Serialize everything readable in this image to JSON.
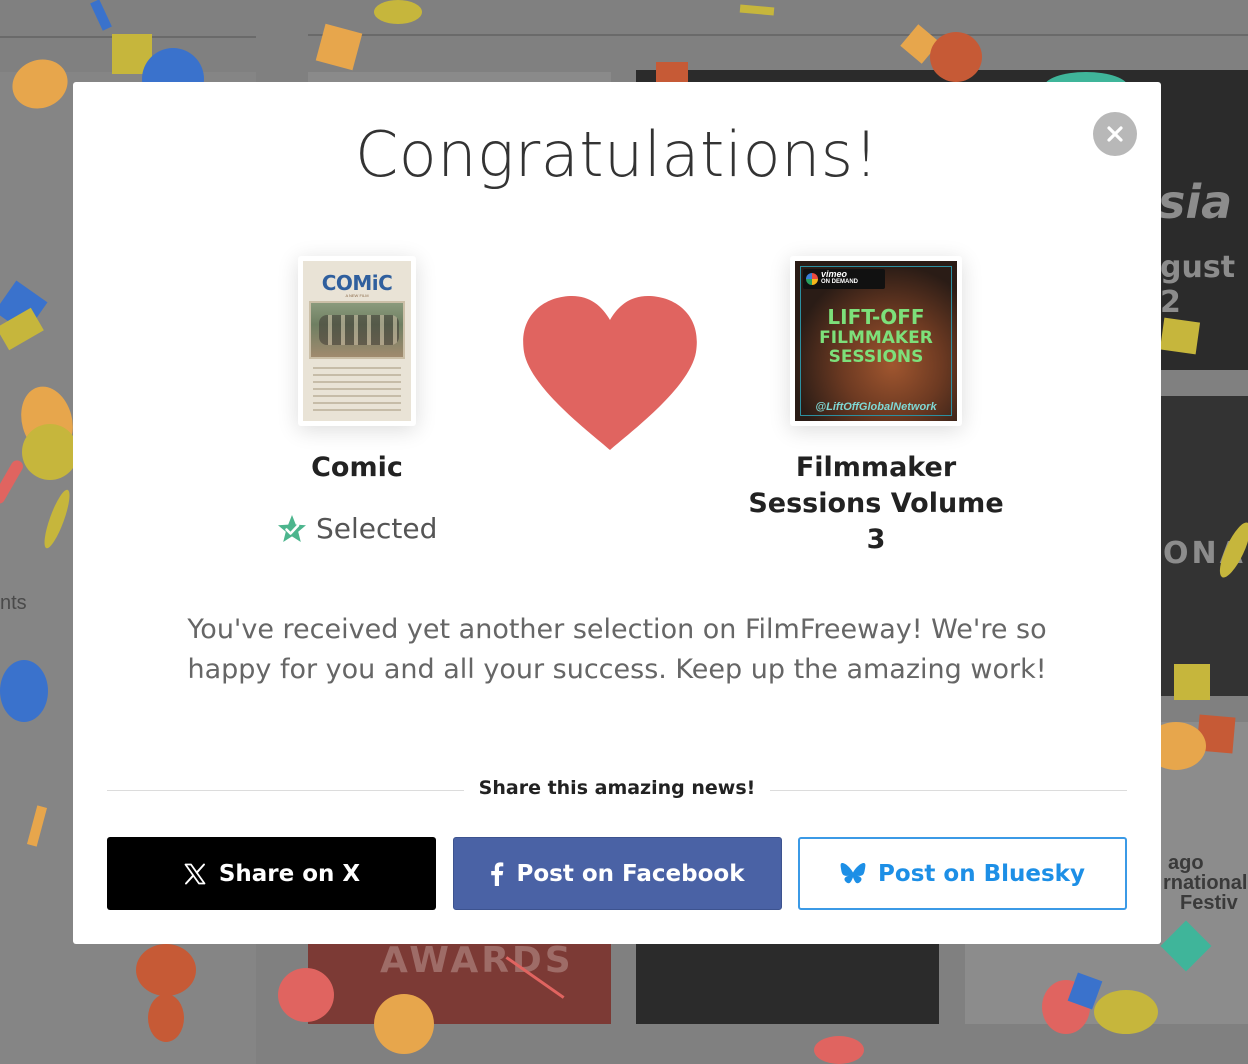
{
  "background": {
    "sidebar_text": "nts",
    "card_text_1": "sia",
    "card_text_2": "gust 2",
    "card_text_3": "ONA",
    "card_text_4": "ago",
    "card_text_5": "rnational",
    "card_text_6": "Festiv",
    "awards_text": "AWARDS"
  },
  "modal": {
    "title": "Congratulations!",
    "close_symbol": "×",
    "film": {
      "title": "Comic",
      "status": "Selected",
      "poster": {
        "title": "COMiC",
        "tagline": "A NEW FILM"
      }
    },
    "festival": {
      "title_line1": "Filmmaker",
      "title_line2": "Sessions Volume",
      "title_line3": "3",
      "poster": {
        "badge_line1": "vimeo",
        "badge_line2": "ON DEMAND",
        "line1": "LIFT-OFF",
        "line2": "FILMMAKER",
        "line3": "SESSIONS",
        "handle": "@LiftOffGlobalNetwork"
      }
    },
    "message": "You've received yet another selection on FilmFreeway! We're so happy for you and all your success. Keep up the amazing work!",
    "share_heading": "Share this amazing news!",
    "buttons": {
      "x": "Share on X",
      "facebook": "Post on Facebook",
      "bluesky": "Post on Bluesky"
    }
  },
  "colors": {
    "heart": "#e06460",
    "selected_star": "#4cb58d",
    "facebook": "#4a62a5",
    "bluesky": "#1d8fe6"
  },
  "icons": [
    "close-icon",
    "heart-icon",
    "star-check-icon",
    "x-logo-icon",
    "facebook-icon",
    "bluesky-butterfly-icon"
  ]
}
